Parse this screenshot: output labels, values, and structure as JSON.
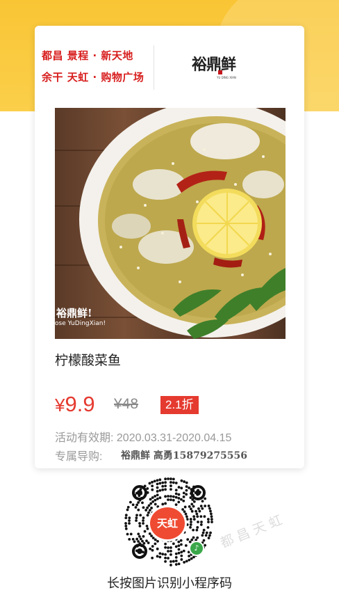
{
  "header": {
    "stores_line1": "都昌 景程 · 新天地",
    "stores_line2": "余干 天虹 · 购物广场",
    "logo_text": "裕鼎鲜",
    "logo_sub": "YU DING XIAN"
  },
  "photo": {
    "watermark_text": "裕鼎鲜!",
    "watermark_sub": "ose YuDingXian!"
  },
  "product": {
    "title": "柠檬酸菜鱼",
    "price_currency": "¥",
    "price_value": "9.9",
    "original_price": "¥48",
    "discount_badge": "2.1折",
    "validity": "活动有效期: 2020.03.31-2020.04.15",
    "guide_label": "专属导购:",
    "guide_value": "裕鼎鲜 高勇15879275556"
  },
  "qr": {
    "center_text": "天虹",
    "badge_icon": "miniprogram-icon"
  },
  "page_watermark": "都昌天虹",
  "caption": "长按图片识别小程序码",
  "colors": {
    "accent_red": "#e53a2f",
    "store_red": "#d81e1e",
    "background_yellow": "#f9c535"
  }
}
